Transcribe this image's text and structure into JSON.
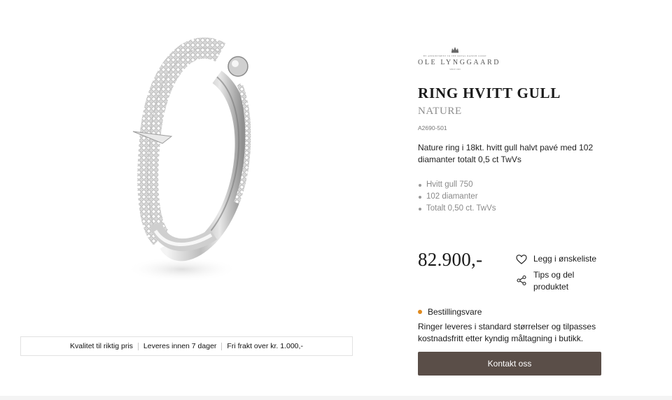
{
  "product": {
    "title": "RING HVITT GULL",
    "collection": "NATURE",
    "sku": "A2690-501",
    "description": "Nature ring i 18kt. hvitt gull halvt pavé med 102 diamanter totalt 0,5 ct TwVs",
    "specs": [
      "Hvitt gull 750",
      "102 diamanter",
      "Totalt 0,50 ct. TwVs"
    ],
    "price": "82.900,-",
    "image_icon": "diamond-ring-image"
  },
  "brand": {
    "appointment": "BY APPOINTMENT TO THE ROYAL DANISH COURT",
    "name": "OLE LYNGGAARD",
    "since": "SINCE 1963",
    "icon": "crown-icon"
  },
  "actions": {
    "wishlist": {
      "label": "Legg i ønskeliste",
      "icon": "heart-icon"
    },
    "share": {
      "label": "Tips og del produktet",
      "icon": "share-icon"
    }
  },
  "availability": {
    "status": "Bestillingsvare",
    "status_color": "#e08a1e",
    "note": "Ringer leveres i standard størrelser og tilpasses kostnadsfritt etter kyndig måltagning i butikk."
  },
  "cta": {
    "label": "Kontakt oss",
    "color": "#5a4e48"
  },
  "usp": [
    "Kvalitet til riktig pris",
    "Leveres innen 7 dager",
    "Fri frakt over kr. 1.000,-"
  ]
}
